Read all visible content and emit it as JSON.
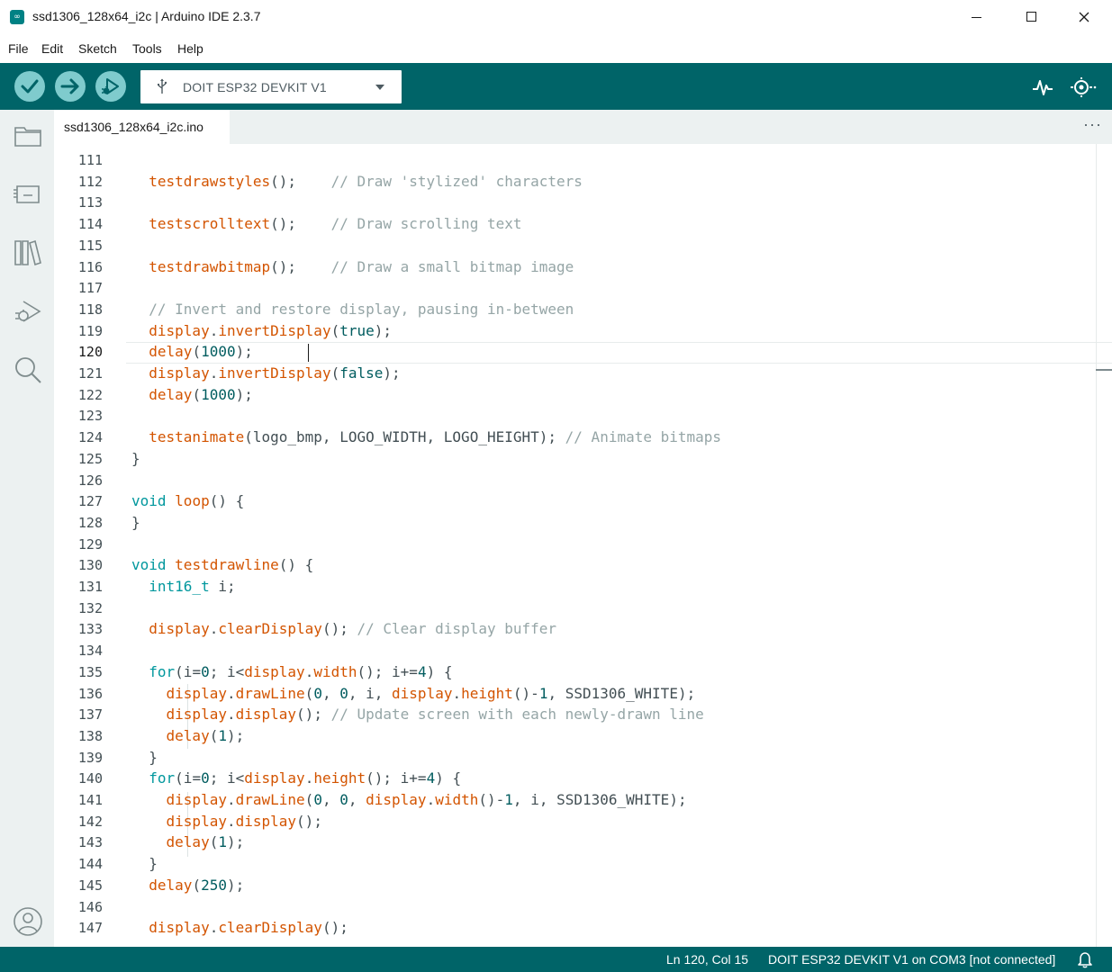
{
  "window": {
    "title": "ssd1306_128x64_i2c | Arduino IDE 2.3.7",
    "icon": "arduino-logo-icon"
  },
  "menu": [
    "File",
    "Edit",
    "Sketch",
    "Tools",
    "Help"
  ],
  "toolbar": {
    "board": "DOIT ESP32 DEVKIT V1",
    "buttons": [
      "verify-icon",
      "upload-icon",
      "debug-icon"
    ],
    "right_icons": [
      "serial-plotter-icon",
      "serial-monitor-icon"
    ]
  },
  "sidebar": {
    "icons": [
      "sketchbook-folder-icon",
      "boards-manager-icon",
      "library-manager-icon",
      "debug-icon",
      "search-icon",
      "profile-icon"
    ]
  },
  "tabs": [
    {
      "label": "ssd1306_128x64_i2c.ino"
    }
  ],
  "tab_more": "···",
  "editor": {
    "active_line": "120",
    "lines": [
      {
        "n": "111",
        "tokens": []
      },
      {
        "n": "112",
        "tokens": [
          [
            "p",
            "  "
          ],
          [
            "f",
            "testdrawstyles"
          ],
          [
            "p",
            "();    "
          ],
          [
            "c",
            "// Draw 'stylized' characters"
          ]
        ]
      },
      {
        "n": "113",
        "tokens": []
      },
      {
        "n": "114",
        "tokens": [
          [
            "p",
            "  "
          ],
          [
            "f",
            "testscrolltext"
          ],
          [
            "p",
            "();    "
          ],
          [
            "c",
            "// Draw scrolling text"
          ]
        ]
      },
      {
        "n": "115",
        "tokens": []
      },
      {
        "n": "116",
        "tokens": [
          [
            "p",
            "  "
          ],
          [
            "f",
            "testdrawbitmap"
          ],
          [
            "p",
            "();    "
          ],
          [
            "c",
            "// Draw a small bitmap image"
          ]
        ]
      },
      {
        "n": "117",
        "tokens": []
      },
      {
        "n": "118",
        "tokens": [
          [
            "p",
            "  "
          ],
          [
            "c",
            "// Invert and restore display, pausing in-between"
          ]
        ]
      },
      {
        "n": "119",
        "tokens": [
          [
            "p",
            "  "
          ],
          [
            "f",
            "display"
          ],
          [
            "p",
            "."
          ],
          [
            "f",
            "invertDisplay"
          ],
          [
            "p",
            "("
          ],
          [
            "n",
            "true"
          ],
          [
            "p",
            ");"
          ]
        ]
      },
      {
        "n": "120",
        "tokens": [
          [
            "p",
            "  "
          ],
          [
            "f",
            "delay"
          ],
          [
            "p",
            "("
          ],
          [
            "n",
            "1000"
          ],
          [
            "p",
            ");"
          ]
        ]
      },
      {
        "n": "121",
        "tokens": [
          [
            "p",
            "  "
          ],
          [
            "f",
            "display"
          ],
          [
            "p",
            "."
          ],
          [
            "f",
            "invertDisplay"
          ],
          [
            "p",
            "("
          ],
          [
            "n",
            "false"
          ],
          [
            "p",
            ");"
          ]
        ]
      },
      {
        "n": "122",
        "tokens": [
          [
            "p",
            "  "
          ],
          [
            "f",
            "delay"
          ],
          [
            "p",
            "("
          ],
          [
            "n",
            "1000"
          ],
          [
            "p",
            ");"
          ]
        ]
      },
      {
        "n": "123",
        "tokens": []
      },
      {
        "n": "124",
        "tokens": [
          [
            "p",
            "  "
          ],
          [
            "f",
            "testanimate"
          ],
          [
            "p",
            "(logo_bmp, LOGO_WIDTH, LOGO_HEIGHT); "
          ],
          [
            "c",
            "// Animate bitmaps"
          ]
        ]
      },
      {
        "n": "125",
        "tokens": [
          [
            "p",
            "}"
          ]
        ]
      },
      {
        "n": "126",
        "tokens": []
      },
      {
        "n": "127",
        "tokens": [
          [
            "k",
            "void"
          ],
          [
            "p",
            " "
          ],
          [
            "f",
            "loop"
          ],
          [
            "p",
            "() {"
          ]
        ]
      },
      {
        "n": "128",
        "tokens": [
          [
            "p",
            "}"
          ]
        ]
      },
      {
        "n": "129",
        "tokens": []
      },
      {
        "n": "130",
        "tokens": [
          [
            "k",
            "void"
          ],
          [
            "p",
            " "
          ],
          [
            "f",
            "testdrawline"
          ],
          [
            "p",
            "() {"
          ]
        ]
      },
      {
        "n": "131",
        "tokens": [
          [
            "p",
            "  "
          ],
          [
            "k",
            "int16_t"
          ],
          [
            "p",
            " i;"
          ]
        ]
      },
      {
        "n": "132",
        "tokens": []
      },
      {
        "n": "133",
        "tokens": [
          [
            "p",
            "  "
          ],
          [
            "f",
            "display"
          ],
          [
            "p",
            "."
          ],
          [
            "f",
            "clearDisplay"
          ],
          [
            "p",
            "(); "
          ],
          [
            "c",
            "// Clear display buffer"
          ]
        ]
      },
      {
        "n": "134",
        "tokens": []
      },
      {
        "n": "135",
        "tokens": [
          [
            "p",
            "  "
          ],
          [
            "k",
            "for"
          ],
          [
            "p",
            "(i="
          ],
          [
            "n",
            "0"
          ],
          [
            "p",
            "; i<"
          ],
          [
            "f",
            "display"
          ],
          [
            "p",
            "."
          ],
          [
            "f",
            "width"
          ],
          [
            "p",
            "(); i+="
          ],
          [
            "n",
            "4"
          ],
          [
            "p",
            ") {"
          ]
        ]
      },
      {
        "n": "136",
        "tokens": [
          [
            "p",
            "    "
          ],
          [
            "f",
            "display"
          ],
          [
            "p",
            "."
          ],
          [
            "f",
            "drawLine"
          ],
          [
            "p",
            "("
          ],
          [
            "n",
            "0"
          ],
          [
            "p",
            ", "
          ],
          [
            "n",
            "0"
          ],
          [
            "p",
            ", i, "
          ],
          [
            "f",
            "display"
          ],
          [
            "p",
            "."
          ],
          [
            "f",
            "height"
          ],
          [
            "p",
            "()-"
          ],
          [
            "n",
            "1"
          ],
          [
            "p",
            ", SSD1306_WHITE);"
          ]
        ]
      },
      {
        "n": "137",
        "tokens": [
          [
            "p",
            "    "
          ],
          [
            "f",
            "display"
          ],
          [
            "p",
            "."
          ],
          [
            "f",
            "display"
          ],
          [
            "p",
            "(); "
          ],
          [
            "c",
            "// Update screen with each newly-drawn line"
          ]
        ]
      },
      {
        "n": "138",
        "tokens": [
          [
            "p",
            "    "
          ],
          [
            "f",
            "delay"
          ],
          [
            "p",
            "("
          ],
          [
            "n",
            "1"
          ],
          [
            "p",
            ");"
          ]
        ]
      },
      {
        "n": "139",
        "tokens": [
          [
            "p",
            "  }"
          ]
        ]
      },
      {
        "n": "140",
        "tokens": [
          [
            "p",
            "  "
          ],
          [
            "k",
            "for"
          ],
          [
            "p",
            "(i="
          ],
          [
            "n",
            "0"
          ],
          [
            "p",
            "; i<"
          ],
          [
            "f",
            "display"
          ],
          [
            "p",
            "."
          ],
          [
            "f",
            "height"
          ],
          [
            "p",
            "(); i+="
          ],
          [
            "n",
            "4"
          ],
          [
            "p",
            ") {"
          ]
        ]
      },
      {
        "n": "141",
        "tokens": [
          [
            "p",
            "    "
          ],
          [
            "f",
            "display"
          ],
          [
            "p",
            "."
          ],
          [
            "f",
            "drawLine"
          ],
          [
            "p",
            "("
          ],
          [
            "n",
            "0"
          ],
          [
            "p",
            ", "
          ],
          [
            "n",
            "0"
          ],
          [
            "p",
            ", "
          ],
          [
            "f",
            "display"
          ],
          [
            "p",
            "."
          ],
          [
            "f",
            "width"
          ],
          [
            "p",
            "()-"
          ],
          [
            "n",
            "1"
          ],
          [
            "p",
            ", i, SSD1306_WHITE);"
          ]
        ]
      },
      {
        "n": "142",
        "tokens": [
          [
            "p",
            "    "
          ],
          [
            "f",
            "display"
          ],
          [
            "p",
            "."
          ],
          [
            "f",
            "display"
          ],
          [
            "p",
            "();"
          ]
        ]
      },
      {
        "n": "143",
        "tokens": [
          [
            "p",
            "    "
          ],
          [
            "f",
            "delay"
          ],
          [
            "p",
            "("
          ],
          [
            "n",
            "1"
          ],
          [
            "p",
            ");"
          ]
        ]
      },
      {
        "n": "144",
        "tokens": [
          [
            "p",
            "  }"
          ]
        ]
      },
      {
        "n": "145",
        "tokens": [
          [
            "p",
            "  "
          ],
          [
            "f",
            "delay"
          ],
          [
            "p",
            "("
          ],
          [
            "n",
            "250"
          ],
          [
            "p",
            ");"
          ]
        ]
      },
      {
        "n": "146",
        "tokens": []
      },
      {
        "n": "147",
        "tokens": [
          [
            "p",
            "  "
          ],
          [
            "f",
            "display"
          ],
          [
            "p",
            "."
          ],
          [
            "f",
            "clearDisplay"
          ],
          [
            "p",
            "();"
          ]
        ]
      }
    ]
  },
  "status": {
    "position": "Ln 120, Col 15",
    "board": "DOIT ESP32 DEVKIT V1 on COM3 [not connected]",
    "bell_icon": "notifications-bell-icon"
  },
  "colors": {
    "toolbar": "#006468",
    "button": "#7fcbcd",
    "keyword": "#00979d",
    "function": "#d35400",
    "comment": "#95a5a6"
  }
}
